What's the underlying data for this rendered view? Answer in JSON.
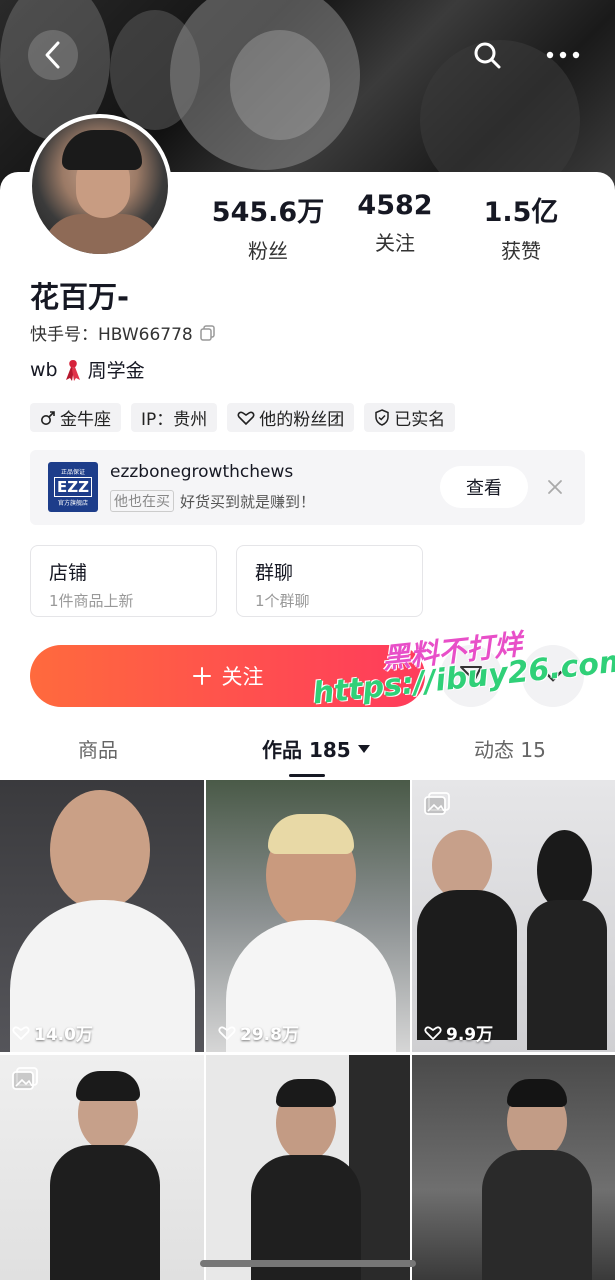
{
  "profile": {
    "name": "花百万-",
    "uid": "快手号：HBW66778",
    "bio_prefix": "wb",
    "bio_suffix": "周学金",
    "stats": [
      {
        "value": "545.6万",
        "label": "粉丝"
      },
      {
        "value": "4582",
        "label": "关注"
      },
      {
        "value": "1.5亿",
        "label": "获赞"
      }
    ],
    "tags": [
      {
        "icon": "male-icon",
        "label": "金牛座"
      },
      {
        "icon": "",
        "label": "IP：贵州"
      },
      {
        "icon": "heart-badge-icon",
        "label": "他的粉丝团"
      },
      {
        "icon": "verified-shield-icon",
        "label": "已实名"
      }
    ]
  },
  "shop_banner": {
    "logo_top": "正品保证",
    "logo_main": "EZZ",
    "logo_bottom": "官方旗舰店",
    "name": "ezzbonegrowthchews",
    "chip": "他也在买",
    "slogan": "好货买到就是赚到！",
    "view_label": "查看"
  },
  "entries": [
    {
      "title": "店铺",
      "subtitle": "1件商品上新"
    },
    {
      "title": "群聊",
      "subtitle": "1个群聊"
    }
  ],
  "follow_label": "关注",
  "watermark": {
    "line1": "黑料不打烊",
    "line2": "https://ibuy26.com"
  },
  "tabs": [
    {
      "label": "商品"
    },
    {
      "label": "作品 185"
    },
    {
      "label": "动态 15"
    }
  ],
  "grid": [
    {
      "likes": "14.0万",
      "has_album_icon": false
    },
    {
      "likes": "29.8万",
      "has_album_icon": false
    },
    {
      "likes": "9.9万",
      "has_album_icon": true
    },
    {
      "likes": "",
      "has_album_icon": true
    },
    {
      "likes": "",
      "has_album_icon": false
    },
    {
      "likes": "",
      "has_album_icon": false
    }
  ],
  "colors": {
    "follow_gradient_start": "#ff6a3d",
    "follow_gradient_end": "#ff3b5c",
    "text_primary": "#161823"
  }
}
